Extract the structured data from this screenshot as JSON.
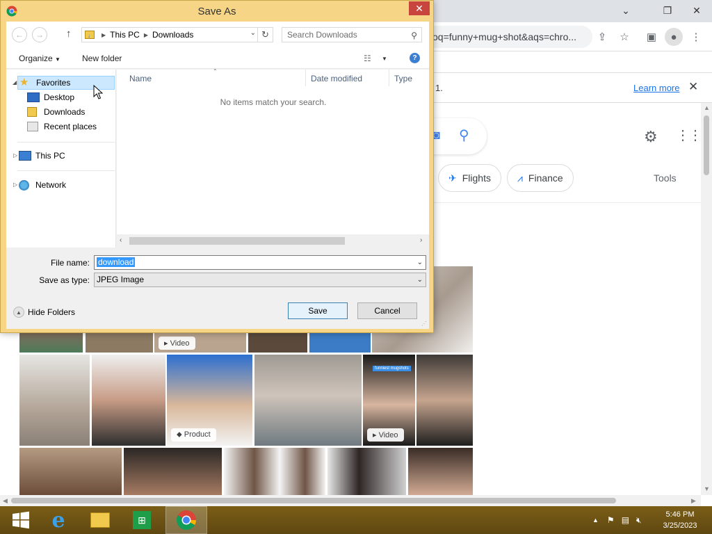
{
  "browser": {
    "omnibox_text": "oq=funny+mug+shot&aqs=chro...",
    "infobar": {
      "text": "1.",
      "learn_more": "Learn more"
    },
    "chips": [
      {
        "label": "Flights",
        "icon": "airplane-icon"
      },
      {
        "label": "Finance",
        "icon": "finance-icon"
      }
    ],
    "tools_label": "Tools",
    "badges": {
      "video": "Video",
      "product": "Product",
      "video2": "Video"
    },
    "thumb_caption": "funniest mugshots"
  },
  "dialog": {
    "title": "Save As",
    "breadcrumb": [
      "This PC",
      "Downloads"
    ],
    "search_placeholder": "Search Downloads",
    "organize_label": "Organize",
    "new_folder_label": "New folder",
    "nav": {
      "favorites": "Favorites",
      "desktop": "Desktop",
      "downloads": "Downloads",
      "recent_places": "Recent places",
      "this_pc": "This PC",
      "network": "Network"
    },
    "columns": {
      "name": "Name",
      "date_modified": "Date modified",
      "type": "Type"
    },
    "empty_message": "No items match your search.",
    "file_name_label": "File name:",
    "file_name_value": "download",
    "save_as_type_label": "Save as type:",
    "save_as_type_value": "JPEG Image",
    "hide_folders_label": "Hide Folders",
    "save_button": "Save",
    "cancel_button": "Cancel"
  },
  "taskbar": {
    "time": "5:46 PM",
    "date": "3/25/2023"
  }
}
